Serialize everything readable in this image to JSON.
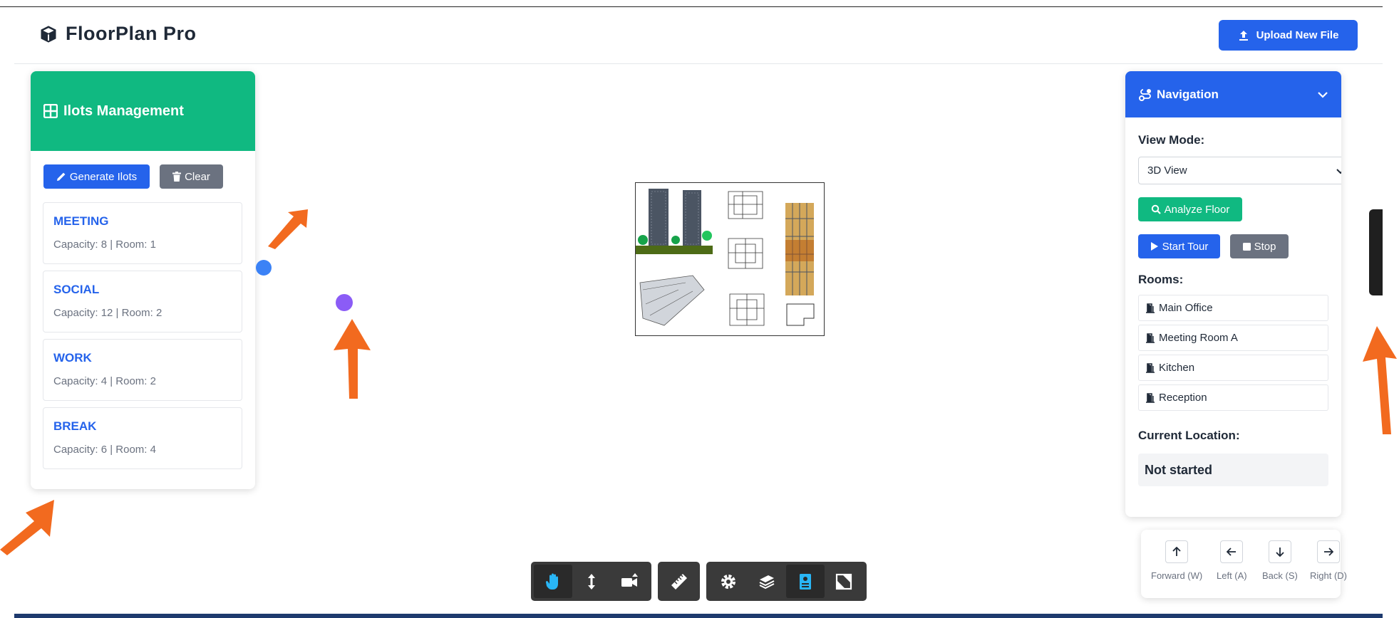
{
  "app": {
    "title": "FloorPlan Pro",
    "upload_label": "Upload New File",
    "accent": "#2563eb",
    "success": "#10b981"
  },
  "ilots": {
    "title": "Ilots Management",
    "generate_label": "Generate Ilots",
    "clear_label": "Clear",
    "items": [
      {
        "type": "MEETING",
        "meta": "Capacity: 8 | Room: 1"
      },
      {
        "type": "SOCIAL",
        "meta": "Capacity: 12 | Room: 2"
      },
      {
        "type": "WORK",
        "meta": "Capacity: 4 | Room: 2"
      },
      {
        "type": "BREAK",
        "meta": "Capacity: 6 | Room: 4"
      }
    ]
  },
  "navigation": {
    "title": "Navigation",
    "view_mode_label": "View Mode:",
    "view_mode_value": "3D View",
    "analyze_label": "Analyze Floor",
    "start_tour_label": "Start Tour",
    "stop_label": "Stop",
    "rooms_label": "Rooms:",
    "rooms": [
      "Main Office",
      "Meeting Room A",
      "Kitchen",
      "Reception"
    ],
    "current_location_label": "Current Location:",
    "current_location_value": "Not started"
  },
  "controls": {
    "forward": "Forward (W)",
    "left": "Left (A)",
    "back": "Back (S)",
    "right": "Right (D)"
  },
  "toolbar": {
    "tools": [
      "pan-icon",
      "dolly-icon",
      "camera-icon",
      "measure-icon",
      "settings-icon",
      "layers-icon",
      "properties-icon",
      "fullscreen-icon"
    ]
  }
}
